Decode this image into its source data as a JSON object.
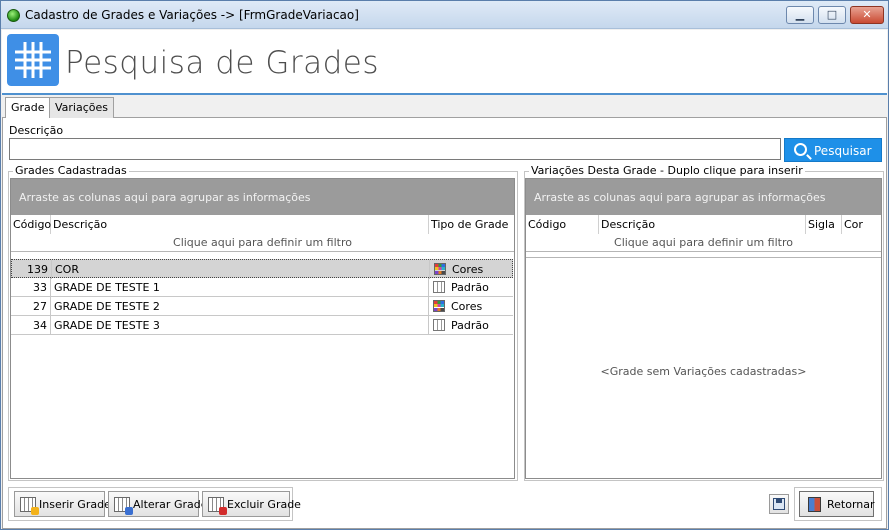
{
  "window": {
    "title": "Cadastro de Grades e Variações -> [FrmGradeVariacao]",
    "min_label": "▁",
    "max_label": "□",
    "close_label": "✕"
  },
  "header": {
    "title": "Pesquisa de Grades",
    "logo_icon": "grid-icon",
    "accent_color": "#3f8fe6"
  },
  "tabs": [
    {
      "label": "Grade",
      "active": true
    },
    {
      "label": "Variações",
      "active": false
    }
  ],
  "search": {
    "label": "Descrição",
    "value": "",
    "button_label": "Pesquisar",
    "button_color": "#1e90e8"
  },
  "grades_panel": {
    "title": "Grades Cadastradas",
    "group_hint": "Arraste as colunas aqui para agrupar as informações",
    "filter_hint": "Clique aqui para definir um filtro",
    "columns": [
      "Código",
      "Descrição",
      "Tipo de Grade"
    ],
    "rows": [
      {
        "codigo": "139",
        "descricao": "COR",
        "tipo": "Cores",
        "tipo_icon": "color-grid-icon",
        "selected": true
      },
      {
        "codigo": "33",
        "descricao": "GRADE DE TESTE 1",
        "tipo": "Padrão",
        "tipo_icon": "plain-grid-icon",
        "selected": false
      },
      {
        "codigo": "27",
        "descricao": "GRADE DE TESTE 2",
        "tipo": "Cores",
        "tipo_icon": "color-grid-icon",
        "selected": false
      },
      {
        "codigo": "34",
        "descricao": "GRADE DE TESTE 3",
        "tipo": "Padrão",
        "tipo_icon": "plain-grid-icon",
        "selected": false
      }
    ]
  },
  "variacoes_panel": {
    "title": "Variações Desta Grade - Duplo clique para inserir",
    "group_hint": "Arraste as colunas aqui para agrupar as informações",
    "filter_hint": "Clique aqui para definir um filtro",
    "columns": [
      "Código",
      "Descrição",
      "Sigla",
      "Cor"
    ],
    "empty_text": "<Grade sem Variações cadastradas>"
  },
  "actions": {
    "insert_label": "Inserir Grade",
    "edit_label": "Alterar Grade",
    "delete_label": "Excluir Grade",
    "return_label": "Retornar"
  }
}
